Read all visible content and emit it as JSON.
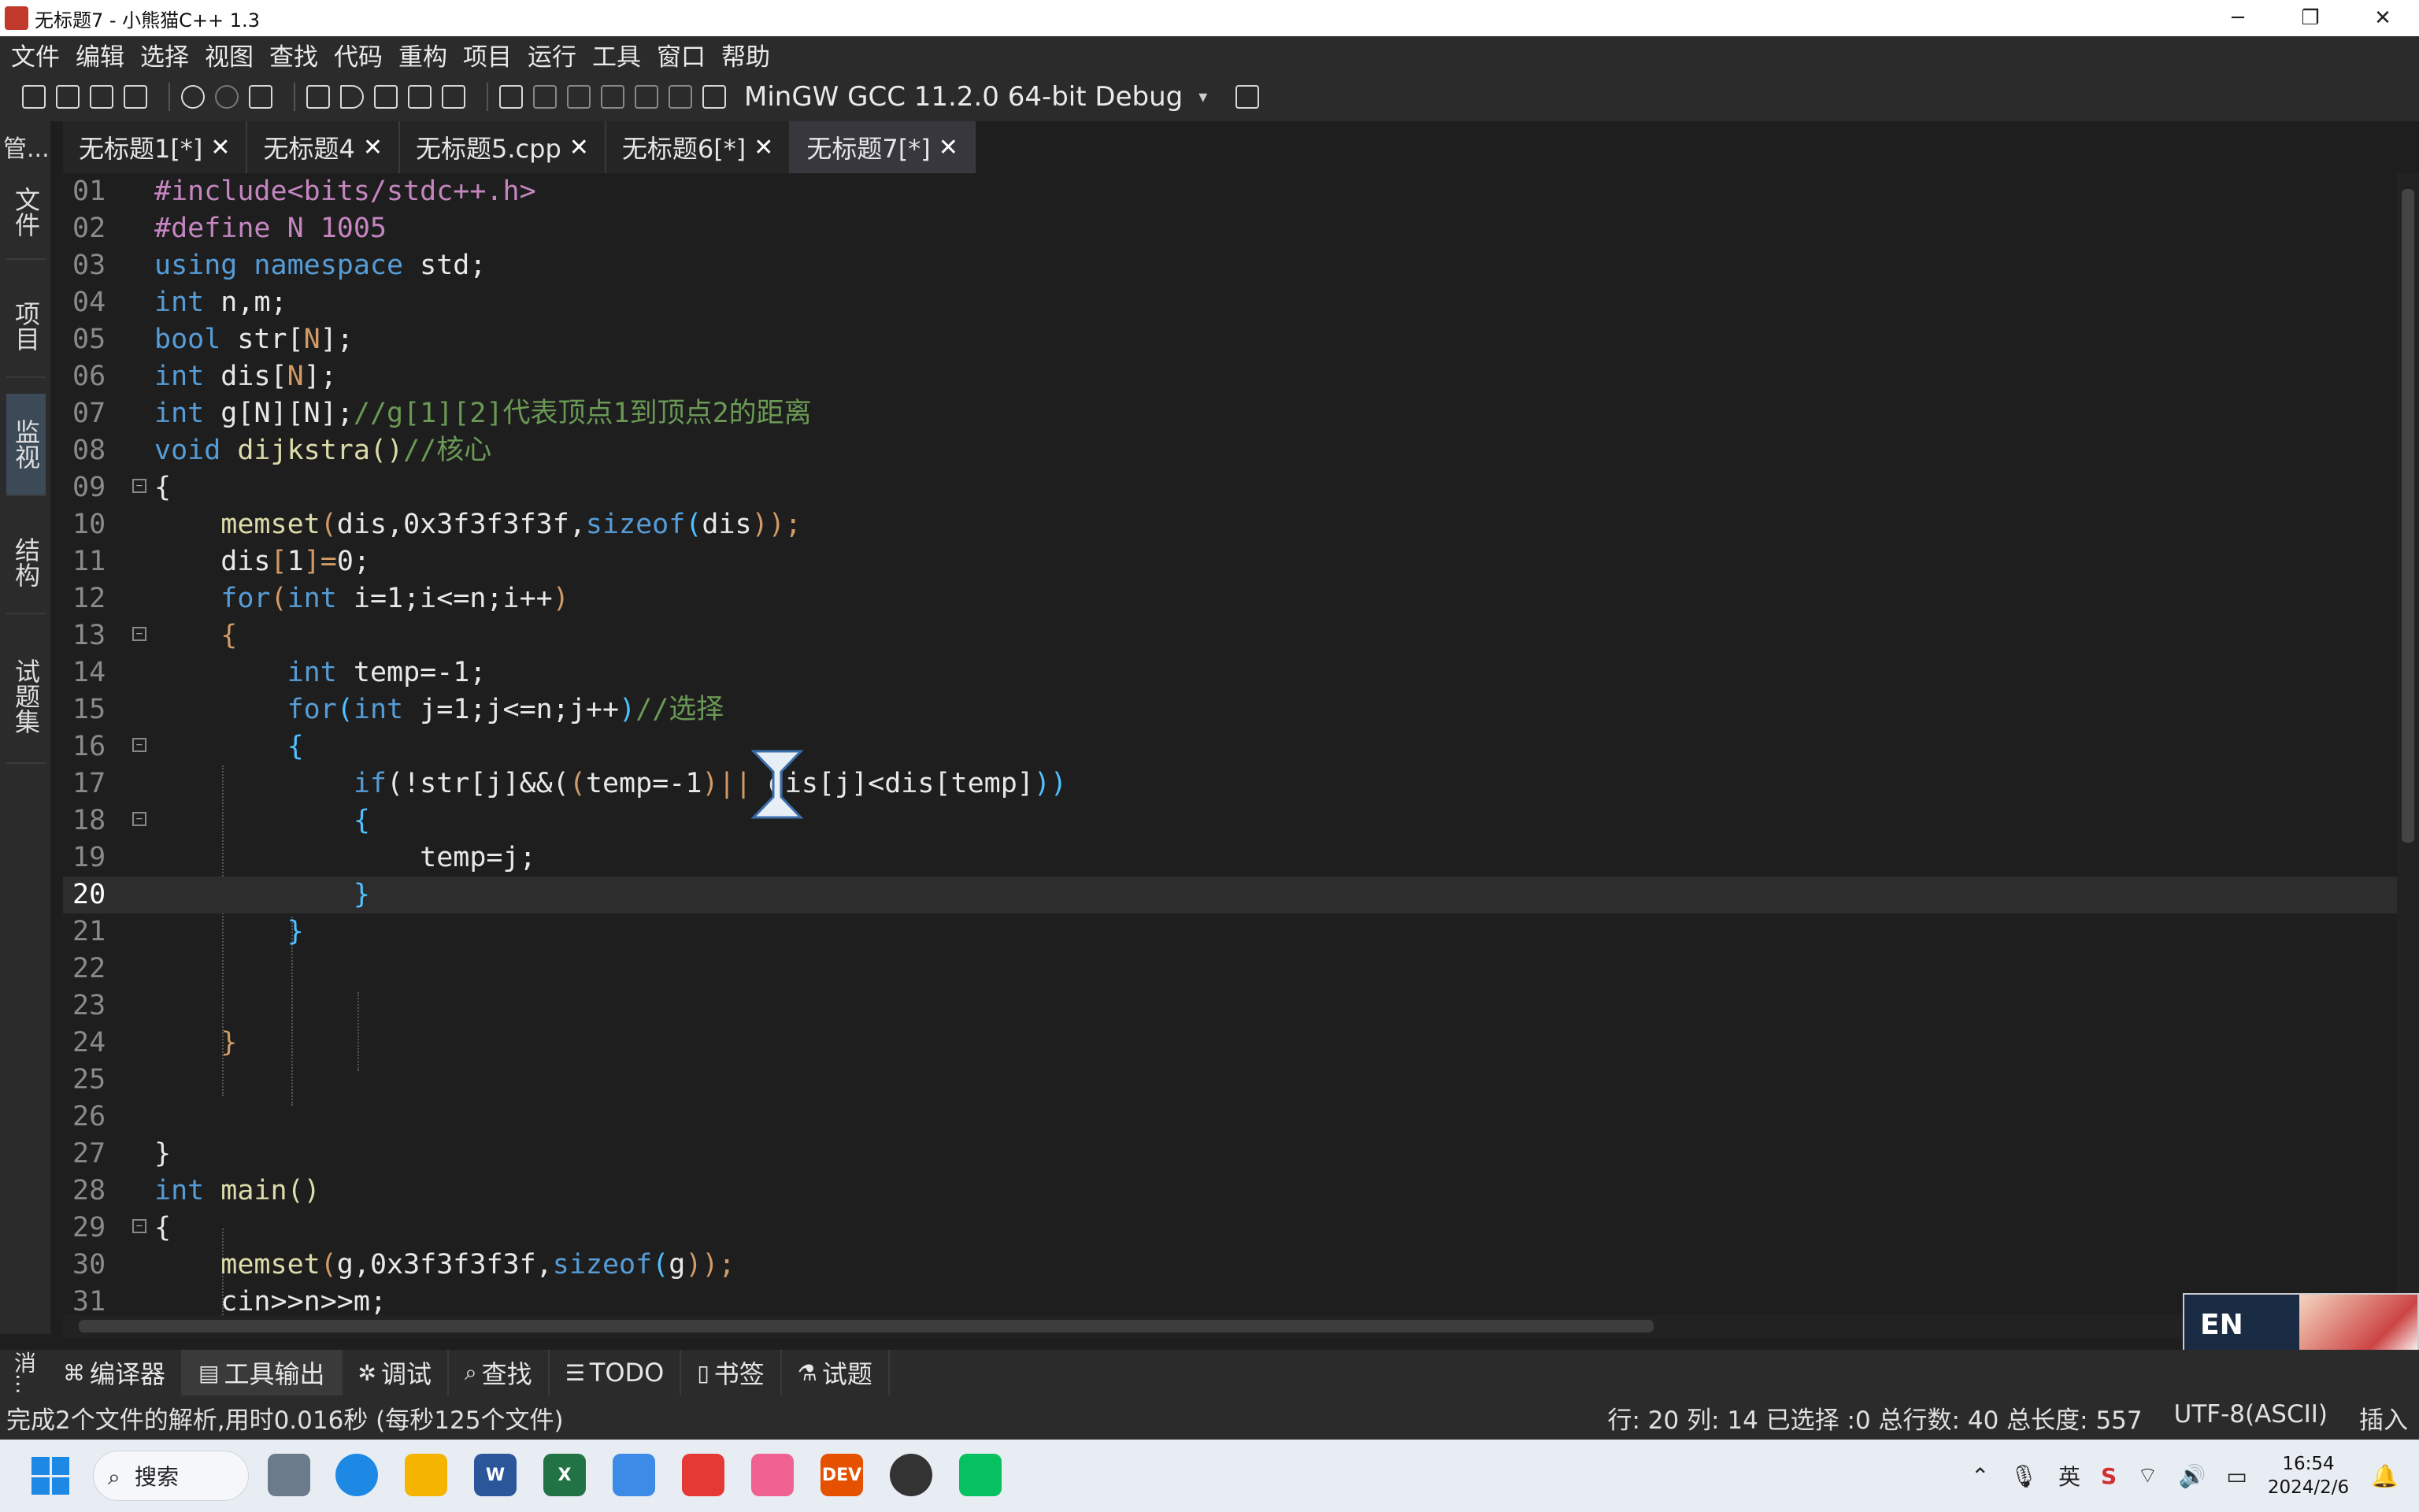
{
  "window": {
    "title": "无标题7 - 小熊猫C++ 1.3",
    "controls": [
      "─",
      "❐",
      "✕"
    ]
  },
  "menu": [
    "文件",
    "编辑",
    "选择",
    "视图",
    "查找",
    "代码",
    "重构",
    "项目",
    "运行",
    "工具",
    "窗口",
    "帮助"
  ],
  "toolbar": {
    "compiler": "MinGW GCC 11.2.0 64-bit Debug",
    "dropdown_glyph": "▾"
  },
  "side": {
    "top_label": "管...",
    "tabs": [
      "文件",
      "项目",
      "监视",
      "结构",
      "试题集"
    ]
  },
  "tabs": [
    {
      "label": "无标题1[*]",
      "close": "✕"
    },
    {
      "label": "无标题4",
      "close": "✕"
    },
    {
      "label": "无标题5.cpp",
      "close": "✕"
    },
    {
      "label": "无标题6[*]",
      "close": "✕"
    },
    {
      "label": "无标题7[*]",
      "close": "✕"
    }
  ],
  "editor": {
    "current_line": "20",
    "line_numbers": [
      "01",
      "02",
      "03",
      "04",
      "05",
      "06",
      "07",
      "08",
      "09",
      "10",
      "11",
      "12",
      "13",
      "14",
      "15",
      "16",
      "17",
      "18",
      "19",
      "20",
      "21",
      "22",
      "23",
      "24",
      "25",
      "26",
      "27",
      "28",
      "29",
      "30",
      "31"
    ],
    "code": {
      "l01": "#include<bits/stdc++.h>",
      "l02": "#define N 1005",
      "l03a": "using namespace ",
      "l03b": "std;",
      "l04a": "int ",
      "l04b": "n,m;",
      "l05a": "bool ",
      "l05b": "str[",
      "l05c": "N",
      "l05d": "];",
      "l06a": "int ",
      "l06b": "dis[",
      "l06c": "N",
      "l06d": "];",
      "l07a": "int ",
      "l07b": "g[N][N];",
      "l07c": "//g[1][2]代表顶点1到顶点2的距离",
      "l08a": "void ",
      "l08b": "dijkstra()",
      "l08c": "//核心",
      "l09": "{",
      "l10a": "    memset",
      "l10b": "(",
      "l10c": "dis,",
      "l10d": "0x3f3f3f3f",
      "l10e": ",",
      "l10f": "sizeof",
      "l10g": "(",
      "l10h": "dis",
      "l10i": "));",
      "l11a": "    dis",
      "l11b": "[",
      "l11c": "1",
      "l11d": "]=",
      "l11e": "0",
      "l11f": ";",
      "l12a": "    for",
      "l12b": "(",
      "l12c": "int ",
      "l12d": "i=1;i<=n;i++",
      "l12e": ")",
      "l13": "    {",
      "l14a": "        int ",
      "l14b": "temp=-1;",
      "l15a": "        for",
      "l15b": "(",
      "l15c": "int ",
      "l15d": "j=1;j<=n;j++",
      "l15e": ")",
      "l15f": "//选择",
      "l16": "        {",
      "l17a": "            if",
      "l17b": "(!str[j]&&(",
      "l17c": "(",
      "l17d": "temp=-1",
      "l17e": ")|| ",
      "l17f": "dis[j]<dis[temp]",
      "l17g": "))",
      "l18": "            {",
      "l19": "                temp=j;",
      "l20": "            }",
      "l21": "        }",
      "l24": "    }",
      "l27": "}",
      "l28a": "int ",
      "l28b": "main()",
      "l29": "{",
      "l30a": "    memset",
      "l30b": "(",
      "l30c": "g,",
      "l30d": "0x3f3f3f3f",
      "l30e": ",",
      "l30f": "sizeof",
      "l30g": "(",
      "l30h": "g",
      "l30i": "));",
      "l31": "    cin>>n>>m;"
    }
  },
  "ime_badge": "EN",
  "bottom_tabs": {
    "side_label": "消...",
    "items": [
      {
        "icon": "⌘",
        "label": "编译器"
      },
      {
        "icon": "▤",
        "label": "工具输出"
      },
      {
        "icon": "✲",
        "label": "调试"
      },
      {
        "icon": "⌕",
        "label": "查找"
      },
      {
        "icon": "☰",
        "label": "TODO"
      },
      {
        "icon": "▯",
        "label": "书签"
      },
      {
        "icon": "⚗",
        "label": "试题"
      }
    ]
  },
  "status": {
    "message": "完成2个文件的解析,用时0.016秒 (每秒125个文件)",
    "position": "行: 20 列: 14 已选择 :0 总行数: 40 总长度: 557",
    "encoding": "UTF-8(ASCII)",
    "mode": "插入"
  },
  "taskbar": {
    "search_label": "搜索",
    "search_glyph": "⌕",
    "apps": [
      "edge",
      "explorer",
      "W",
      "X",
      "store",
      "wps",
      "bili",
      "DEV",
      "obs",
      "wechat"
    ],
    "tray": {
      "chevron": "⌃",
      "mic": "🎙",
      "lang": "英",
      "ime": "S",
      "wifi": "⌔",
      "volume": "🔊",
      "battery": "▭",
      "bell": "🔔",
      "time": "16:54",
      "date": "2024/2/6"
    }
  }
}
